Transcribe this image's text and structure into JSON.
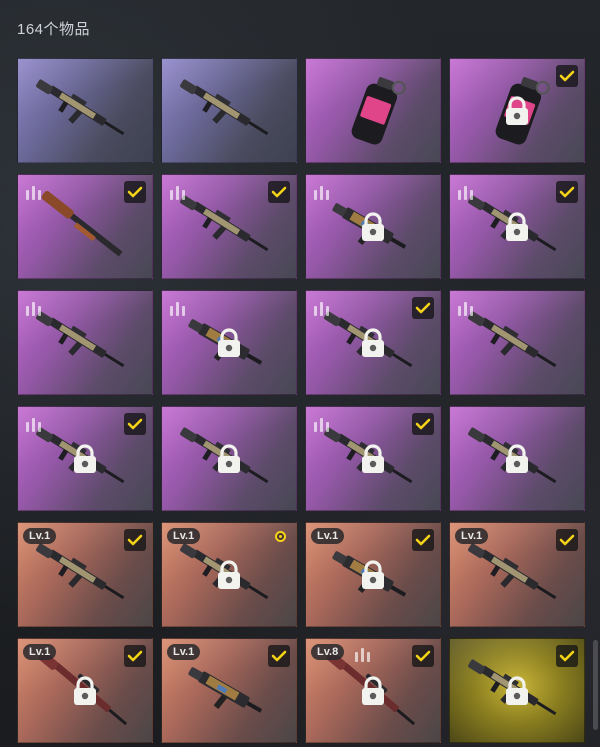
{
  "header": {
    "count_label": "164个物品"
  },
  "colors": {
    "check_yellow": "#f5d417",
    "rarity_blue": "#6b6898",
    "rarity_purple": "#9558a8",
    "rarity_orange": "#a9685a",
    "rarity_gold": "#8d8020"
  },
  "items": [
    {
      "rarity": "blue",
      "icon": "assault-rifle-icon",
      "checked": false,
      "locked": false,
      "level": "",
      "tier_marks": false,
      "pending": false
    },
    {
      "rarity": "blue",
      "icon": "assault-rifle-icon",
      "checked": false,
      "locked": false,
      "level": "",
      "tier_marks": false,
      "pending": false
    },
    {
      "rarity": "purple",
      "icon": "grenade-icon",
      "checked": false,
      "locked": false,
      "level": "",
      "tier_marks": false,
      "pending": false
    },
    {
      "rarity": "purple",
      "icon": "grenade-icon",
      "checked": true,
      "locked": true,
      "level": "",
      "tier_marks": false,
      "pending": false
    },
    {
      "rarity": "purple",
      "icon": "shotgun-icon",
      "checked": true,
      "locked": false,
      "level": "",
      "tier_marks": true,
      "pending": false
    },
    {
      "rarity": "purple",
      "icon": "assault-rifle-icon",
      "checked": true,
      "locked": false,
      "level": "",
      "tier_marks": true,
      "pending": false
    },
    {
      "rarity": "purple",
      "icon": "smg-icon",
      "checked": false,
      "locked": true,
      "level": "",
      "tier_marks": true,
      "pending": false
    },
    {
      "rarity": "purple",
      "icon": "assault-rifle-icon",
      "checked": true,
      "locked": true,
      "level": "",
      "tier_marks": true,
      "pending": false
    },
    {
      "rarity": "purple",
      "icon": "assault-rifle-icon",
      "checked": false,
      "locked": false,
      "level": "",
      "tier_marks": true,
      "pending": false
    },
    {
      "rarity": "purple",
      "icon": "smg-icon",
      "checked": false,
      "locked": true,
      "level": "",
      "tier_marks": true,
      "pending": false
    },
    {
      "rarity": "purple",
      "icon": "assault-rifle-icon",
      "checked": true,
      "locked": true,
      "level": "",
      "tier_marks": true,
      "pending": false
    },
    {
      "rarity": "purple",
      "icon": "assault-rifle-icon",
      "checked": false,
      "locked": false,
      "level": "",
      "tier_marks": true,
      "pending": false
    },
    {
      "rarity": "purple",
      "icon": "assault-rifle-icon",
      "checked": true,
      "locked": true,
      "level": "",
      "tier_marks": true,
      "pending": false
    },
    {
      "rarity": "purple",
      "icon": "assault-rifle-icon",
      "checked": false,
      "locked": true,
      "level": "",
      "tier_marks": false,
      "pending": false
    },
    {
      "rarity": "purple",
      "icon": "assault-rifle-icon",
      "checked": true,
      "locked": true,
      "level": "",
      "tier_marks": true,
      "pending": false
    },
    {
      "rarity": "purple",
      "icon": "assault-rifle-icon",
      "checked": false,
      "locked": true,
      "level": "",
      "tier_marks": false,
      "pending": false
    },
    {
      "rarity": "orange",
      "icon": "assault-rifle-icon",
      "checked": true,
      "locked": false,
      "level": "Lv.1",
      "tier_marks": false,
      "pending": false
    },
    {
      "rarity": "orange",
      "icon": "assault-rifle-icon",
      "checked": false,
      "locked": true,
      "level": "Lv.1",
      "tier_marks": false,
      "pending": true
    },
    {
      "rarity": "orange",
      "icon": "smg-icon",
      "checked": true,
      "locked": true,
      "level": "Lv.1",
      "tier_marks": false,
      "pending": false
    },
    {
      "rarity": "orange",
      "icon": "assault-rifle-icon",
      "checked": true,
      "locked": false,
      "level": "Lv.1",
      "tier_marks": false,
      "pending": false
    },
    {
      "rarity": "orange",
      "icon": "sniper-rifle-icon",
      "checked": true,
      "locked": true,
      "level": "Lv.1",
      "tier_marks": false,
      "pending": false
    },
    {
      "rarity": "orange",
      "icon": "smg-icon",
      "checked": true,
      "locked": false,
      "level": "Lv.1",
      "tier_marks": false,
      "pending": false
    },
    {
      "rarity": "orange",
      "icon": "sniper-rifle-icon",
      "checked": true,
      "locked": true,
      "level": "Lv.8",
      "tier_marks": true,
      "pending": false
    },
    {
      "rarity": "gold",
      "icon": "assault-rifle-icon",
      "checked": true,
      "locked": true,
      "level": "",
      "tier_marks": false,
      "pending": false
    }
  ]
}
